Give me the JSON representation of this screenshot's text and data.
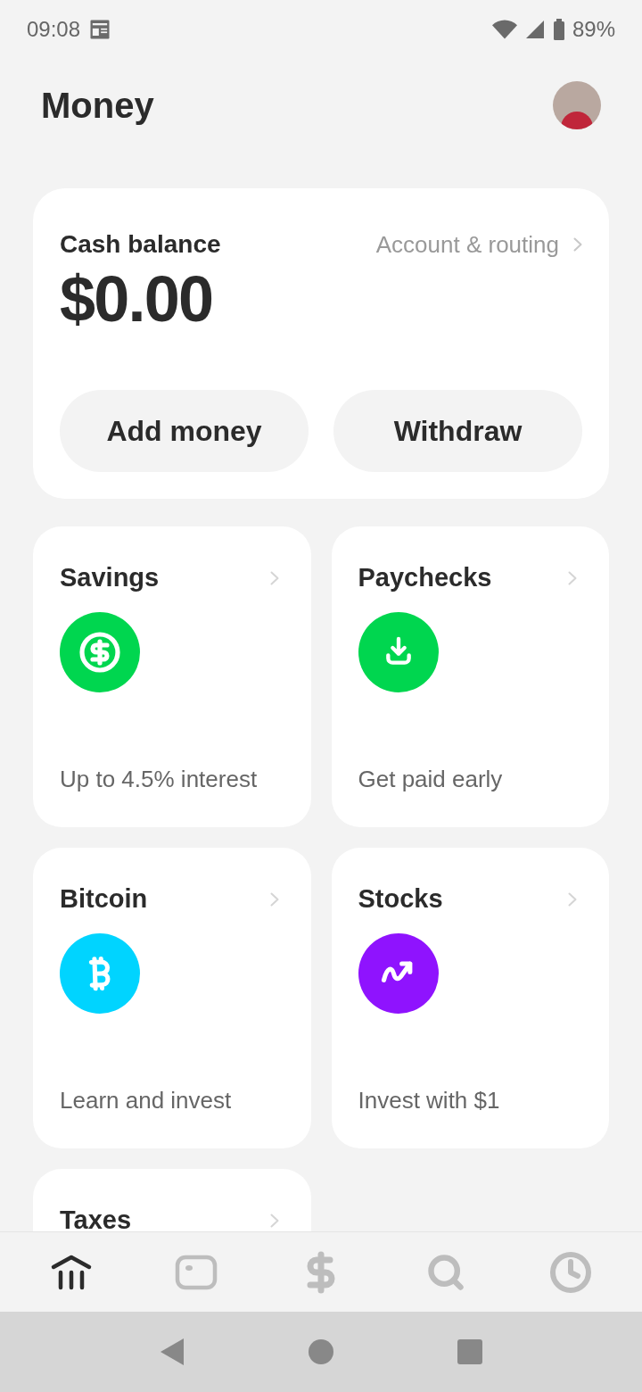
{
  "status_bar": {
    "time": "09:08",
    "battery": "89%"
  },
  "header": {
    "title": "Money"
  },
  "cash_card": {
    "title": "Cash balance",
    "link": "Account & routing",
    "balance": "$0.00",
    "buttons": [
      "Add money",
      "Withdraw"
    ]
  },
  "tiles": [
    {
      "kind": "savings",
      "title": "Savings",
      "caption": "Up to 4.5% interest",
      "color": "#00d64f"
    },
    {
      "kind": "paychecks",
      "title": "Paychecks",
      "caption": "Get paid early",
      "color": "#00d64f"
    },
    {
      "kind": "bitcoin",
      "title": "Bitcoin",
      "caption": "Learn and invest",
      "color": "#00d4ff"
    },
    {
      "kind": "stocks",
      "title": "Stocks",
      "caption": "Invest with $1",
      "color": "#8f13fe"
    },
    {
      "title": "Taxes"
    }
  ],
  "bottom_nav": [
    {
      "kind": "money",
      "selected": true
    },
    {
      "kind": "card",
      "selected": false
    },
    {
      "kind": "pay",
      "selected": false
    },
    {
      "kind": "search",
      "selected": false
    },
    {
      "kind": "activity",
      "selected": false
    }
  ]
}
